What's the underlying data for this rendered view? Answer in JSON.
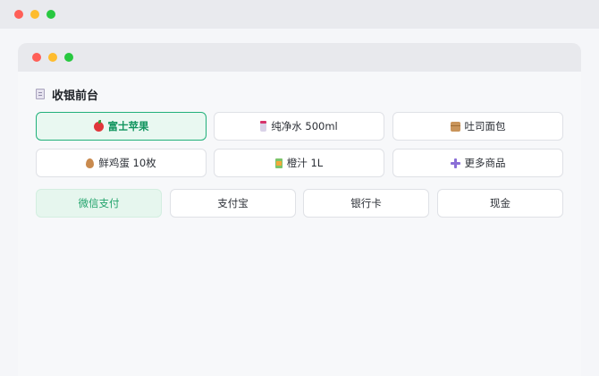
{
  "checkout": {
    "title": "收银前台",
    "products": [
      {
        "label": "富士苹果",
        "icon": "apple-icon",
        "selected": true
      },
      {
        "label": "纯净水 500ml",
        "icon": "water-bottle-icon",
        "selected": false
      },
      {
        "label": "吐司面包",
        "icon": "bread-package-icon",
        "selected": false
      },
      {
        "label": "鲜鸡蛋 10枚",
        "icon": "egg-icon",
        "selected": false
      },
      {
        "label": "橙汁 1L",
        "icon": "juice-box-icon",
        "selected": false
      },
      {
        "label": "更多商品",
        "icon": "plus-icon",
        "selected": false
      }
    ],
    "payments": [
      {
        "label": "微信支付",
        "selected": true
      },
      {
        "label": "支付宝",
        "selected": false
      },
      {
        "label": "银行卡",
        "selected": false
      },
      {
        "label": "现金",
        "selected": false
      }
    ]
  },
  "colors": {
    "accent": "#21b07a",
    "selected_bg": "#e9f8f1"
  }
}
